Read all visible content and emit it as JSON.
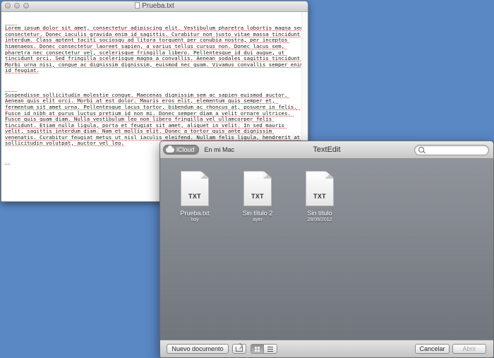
{
  "document_window": {
    "title": "Prueba.txt",
    "paragraphs": [
      "Lorem ipsum dolor sit amet, consectetur adipiscing elit. Vestibulum pharetra lobortis magna sed consectetur. Donec iaculis gravida enim id sagittis. Curabitur non justo vitae massa tincidunt interdum. Class aptent taciti sociosqu ad litora torquent per conubia nostra, per inceptos himenaeos. Donec consectetur laoreet sapien, a varius tellus cursus non. Donec lacus sem, pharetra nec consectetur vel, scelerisque fringilla libero. Pellentesque id dui augue, ut tincidunt orci. Sed fringilla scelerisque magna a convallis. Aenean sodales sagittis tincidunt. Morbi urna nisi, congue ac dignissim dignissim, euismod nec quam. Vivamus convallis semper enim id feugiat.",
      "Suspendisse sollicitudin molestie congue. Maecenas dignissim sem ac sapien euismod auctor. Aenean quis elit orci. Morbi at est dolor. Mauris eros elit, elementum quis semper et, fermentum sit amet urna. Pellentesque lacus tortor, bibendum ac rhoncus at, posuere in felis. Fusce id nibh at purus luctus pretium id non mi. Donec semper diam a velit ornare ultrices. Fusce quis quam diam. Nulla vestibulum leo non libero fringilla vel ullamcorper felis tincidunt. Etiam nulla ligula, porta et feugiat sit amet, aliquet in velit. In sed mauris velit, sagittis interdum diam. Nam et mollis elit. Donec a tortor quis ante dignissim venenatis. Curabitur feugiat metus ut nisl iaculis eleifend. Nullam felis ligula, hendrerit at sollicitudin volutpat, auctor vel leo."
    ]
  },
  "open_dialog": {
    "title": "TextEdit",
    "location_icloud": "iCloud",
    "location_mac": "En mi Mac",
    "search_placeholder": "",
    "files": [
      {
        "name": "Prueba.txt",
        "date": "hoy",
        "ext": "TXT"
      },
      {
        "name": "Sin título 2",
        "date": "ayer",
        "ext": "TXT"
      },
      {
        "name": "Sin título",
        "date": "28/08/2012",
        "ext": "TXT"
      }
    ],
    "buttons": {
      "new_document": "Nuevo documento",
      "cancel": "Cancelar",
      "open": "Abrir"
    }
  }
}
